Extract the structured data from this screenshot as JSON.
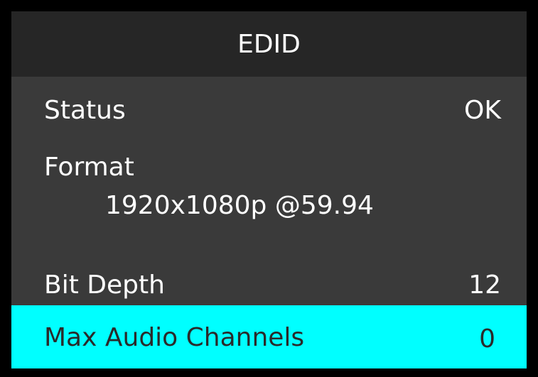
{
  "screen": {
    "title": "EDID"
  },
  "rows": {
    "status": {
      "label": "Status",
      "value": "OK"
    },
    "format": {
      "label": "Format",
      "value": "1920x1080p @59.94"
    },
    "bit_depth": {
      "label": "Bit Depth",
      "value": "12"
    },
    "max_audio_channels": {
      "label": "Max Audio Channels",
      "value": "0"
    }
  },
  "colors": {
    "background": "#3a3a3a",
    "header": "#262626",
    "border": "#000000",
    "highlight": "#00ffff",
    "text": "#ffffff",
    "highlight_text": "#2a2a2a"
  }
}
